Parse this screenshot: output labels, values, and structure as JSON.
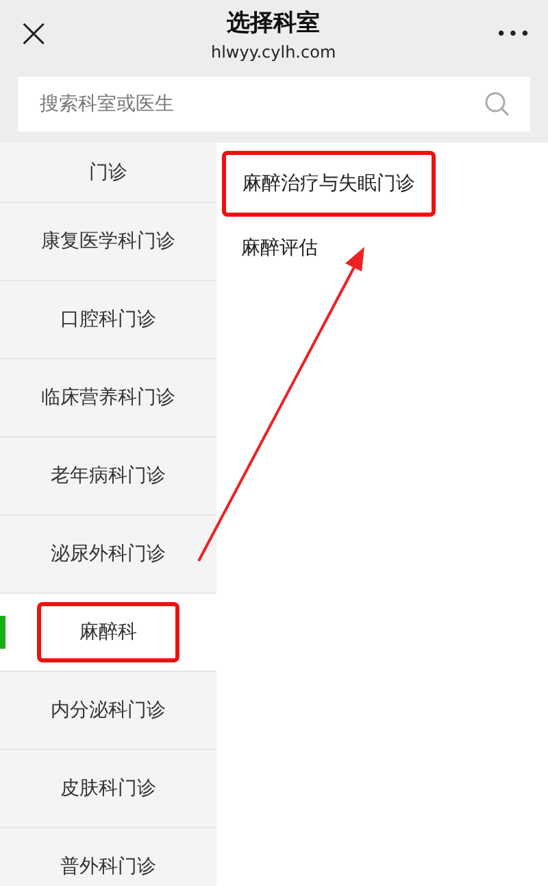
{
  "header": {
    "close": "×",
    "title": "选择科室",
    "subtitle": "hlwyy.cylh.com",
    "more": "•••"
  },
  "search": {
    "placeholder": "搜索科室或医生"
  },
  "departments": [
    {
      "label": "门诊",
      "selected": false,
      "highlighted": false
    },
    {
      "label": "康复医学科门诊",
      "selected": false,
      "highlighted": false
    },
    {
      "label": "口腔科门诊",
      "selected": false,
      "highlighted": false
    },
    {
      "label": "临床营养科门诊",
      "selected": false,
      "highlighted": false
    },
    {
      "label": "老年病科门诊",
      "selected": false,
      "highlighted": false
    },
    {
      "label": "泌尿外科门诊",
      "selected": false,
      "highlighted": false
    },
    {
      "label": "麻醉科",
      "selected": true,
      "highlighted": true
    },
    {
      "label": "内分泌科门诊",
      "selected": false,
      "highlighted": false
    },
    {
      "label": "皮肤科门诊",
      "selected": false,
      "highlighted": false
    },
    {
      "label": "普外科门诊",
      "selected": false,
      "highlighted": false
    }
  ],
  "clinics": [
    {
      "label": "麻醉治疗与失眠门诊",
      "highlighted": true
    },
    {
      "label": "麻醉评估",
      "highlighted": false
    }
  ],
  "annotation": {
    "arrow": true
  }
}
